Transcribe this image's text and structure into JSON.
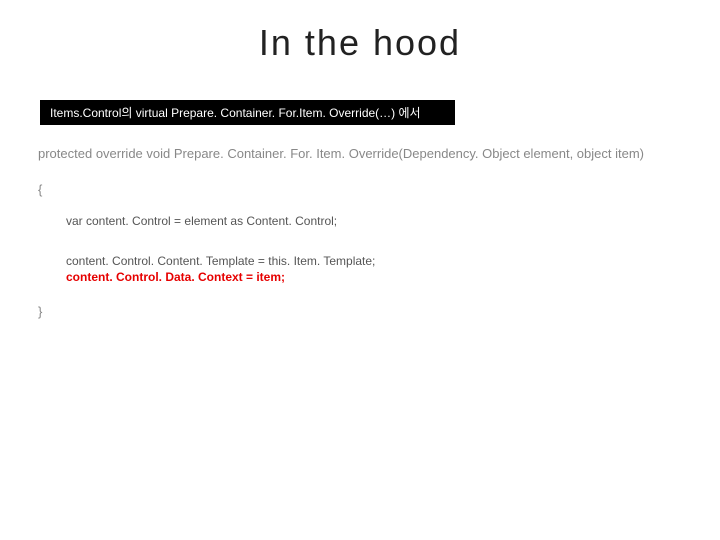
{
  "title": "In the hood",
  "label": "Items.Control의 virtual Prepare. Container. For.Item. Override(…) 에서",
  "code": {
    "signature": "protected override void Prepare. Container. For. Item. Override(Dependency. Object element, object item)",
    "brace_open": "{",
    "line1": "var content. Control = element as Content. Control;",
    "line2": "content. Control. Content. Template = this. Item. Template;",
    "line3": "content. Control. Data. Context = item;",
    "brace_close": "}"
  }
}
